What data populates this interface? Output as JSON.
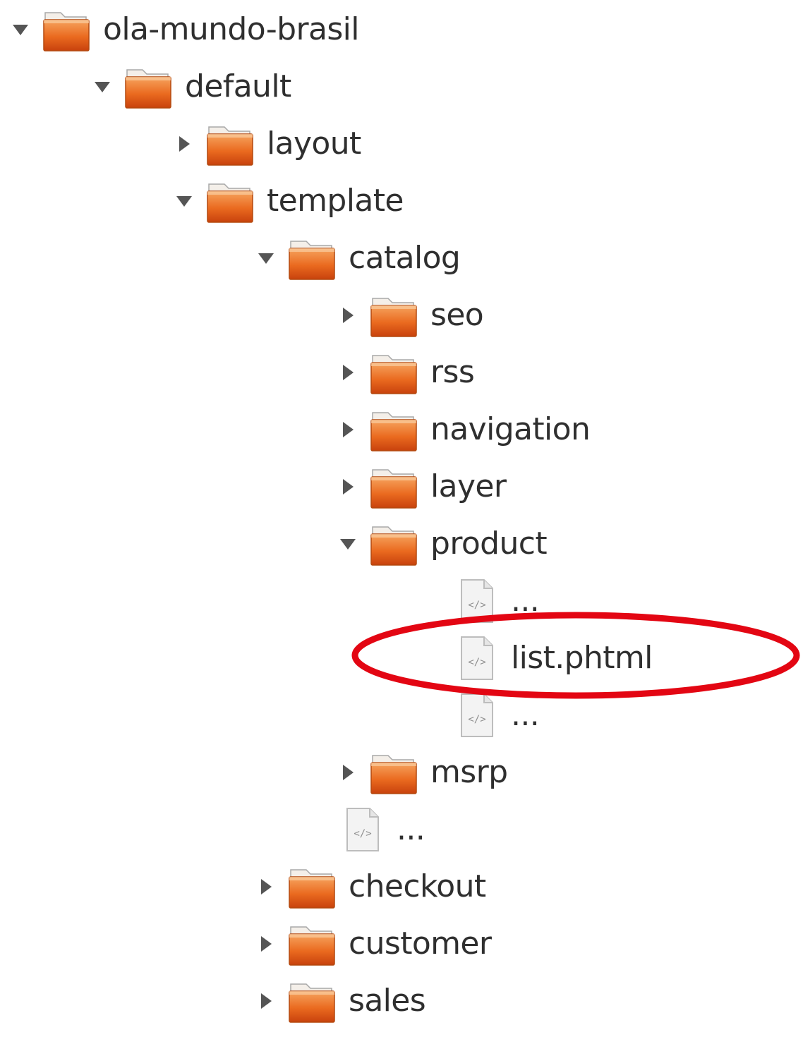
{
  "tree": [
    {
      "label": "ola-mundo-brasil",
      "type": "folder",
      "expanded": true,
      "depth": 0
    },
    {
      "label": "default",
      "type": "folder",
      "expanded": true,
      "depth": 1
    },
    {
      "label": "layout",
      "type": "folder",
      "expanded": false,
      "depth": 2
    },
    {
      "label": "template",
      "type": "folder",
      "expanded": true,
      "depth": 2
    },
    {
      "label": "catalog",
      "type": "folder",
      "expanded": true,
      "depth": 3
    },
    {
      "label": "seo",
      "type": "folder",
      "expanded": false,
      "depth": 4
    },
    {
      "label": "rss",
      "type": "folder",
      "expanded": false,
      "depth": 4
    },
    {
      "label": "navigation",
      "type": "folder",
      "expanded": false,
      "depth": 4
    },
    {
      "label": "layer",
      "type": "folder",
      "expanded": false,
      "depth": 4
    },
    {
      "label": "product",
      "type": "folder",
      "expanded": true,
      "depth": 4
    },
    {
      "label": "...",
      "type": "file",
      "depth": 5
    },
    {
      "label": "list.phtml",
      "type": "file",
      "depth": 5,
      "highlighted": true
    },
    {
      "label": "...",
      "type": "file",
      "depth": 5
    },
    {
      "label": "msrp",
      "type": "folder",
      "expanded": false,
      "depth": 4
    },
    {
      "label": "...",
      "type": "file",
      "depth": 4
    },
    {
      "label": "checkout",
      "type": "folder",
      "expanded": false,
      "depth": 3
    },
    {
      "label": "customer",
      "type": "folder",
      "expanded": false,
      "depth": 3
    },
    {
      "label": "sales",
      "type": "folder",
      "expanded": false,
      "depth": 3
    }
  ],
  "icons": {
    "folder": "folder-icon",
    "file": "code-file-icon",
    "expanded": "triangle-down-icon",
    "collapsed": "triangle-right-icon"
  },
  "colors": {
    "folder_light": "#f6a45f",
    "folder_mid": "#ea6a1f",
    "folder_dark": "#c8420d",
    "folder_tab": "#f4efe9",
    "folder_outline": "#a8a8a8",
    "text": "#2f2f2f",
    "toggle": "#555555",
    "file_fill": "#f3f3f3",
    "file_outline": "#bdbdbd",
    "highlight": "#e30613"
  }
}
